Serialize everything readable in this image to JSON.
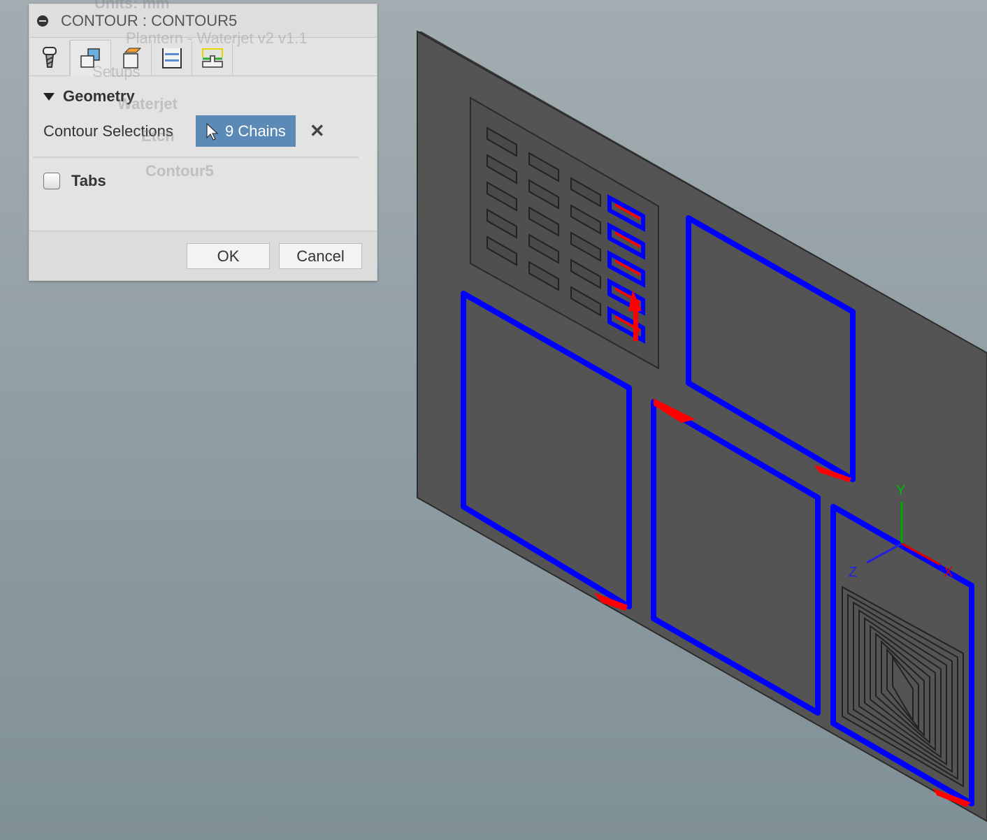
{
  "dialog": {
    "title": "CONTOUR : CONTOUR5",
    "tabs": [
      {
        "icon": "tool-icon"
      },
      {
        "icon": "geometry-icon"
      },
      {
        "icon": "heights-icon"
      },
      {
        "icon": "passes-icon"
      },
      {
        "icon": "linking-icon"
      }
    ],
    "geometry_section": "Geometry",
    "contour_selections_label": "Contour Selections",
    "contour_selections_value": "9 Chains",
    "tabs_label": "Tabs",
    "tabs_checked": false,
    "ok": "OK",
    "cancel": "Cancel"
  },
  "background_browser": {
    "units": "Units: mm",
    "document": "Plantern - Waterjet v2 v1.1",
    "setups": "Setups",
    "setup": "Waterjet",
    "etch": "Etch",
    "operation": "Contour5"
  },
  "viewcube_axes": {
    "x": "X",
    "y": "Y",
    "z": "Z"
  },
  "colors": {
    "selection": "#0000ff",
    "direction_arrow": "#ff0000",
    "plate": "#555555",
    "accent": "#5a8ab5"
  }
}
